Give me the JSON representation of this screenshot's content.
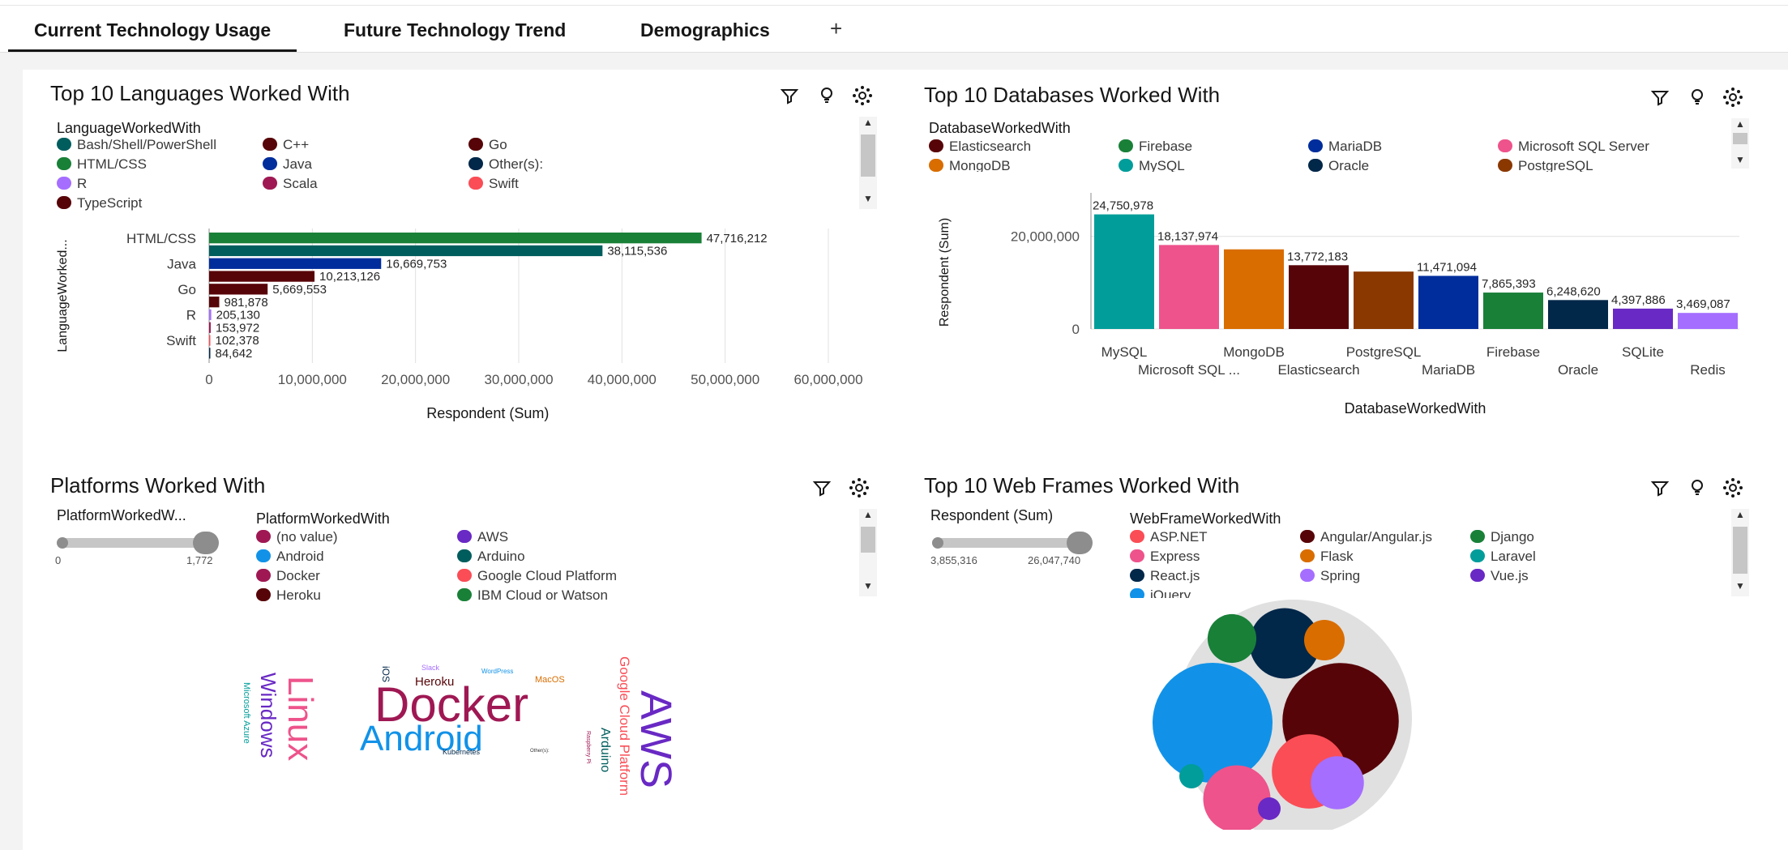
{
  "tabs": [
    {
      "label": "Current Technology Usage"
    },
    {
      "label": "Future Technology Trend"
    },
    {
      "label": "Demographics"
    }
  ],
  "tab_add_label": "+",
  "colors": {
    "accent": "#161616"
  },
  "panels": {
    "languages": {
      "title": "Top 10 Languages Worked With",
      "legend_title": "LanguageWorkedWith",
      "legend": [
        {
          "label": "Bash/Shell/PowerShell",
          "color": "#005d5d"
        },
        {
          "label": "C++",
          "color": "#570408"
        },
        {
          "label": "Go",
          "color": "#570408"
        },
        {
          "label": "HTML/CSS",
          "color": "#198038"
        },
        {
          "label": "Java",
          "color": "#002d9c"
        },
        {
          "label": "Other(s):",
          "color": "#012749"
        },
        {
          "label": "R",
          "color": "#a56eff"
        },
        {
          "label": "Scala",
          "color": "#9f1853"
        },
        {
          "label": "Swift",
          "color": "#fa4d56"
        },
        {
          "label": "TypeScript",
          "color": "#570408"
        }
      ],
      "ylabel": "LanguageWorked...",
      "xlabel": "Respondent (Sum)"
    },
    "databases": {
      "title": "Top 10 Databases Worked With",
      "legend_title": "DatabaseWorkedWith",
      "legend": [
        {
          "label": "Elasticsearch",
          "color": "#570408"
        },
        {
          "label": "Firebase",
          "color": "#198038"
        },
        {
          "label": "MariaDB",
          "color": "#002d9c"
        },
        {
          "label": "Microsoft SQL Server",
          "color": "#ee538b"
        },
        {
          "label": "MongoDB",
          "color": "#d96d00"
        },
        {
          "label": "MySQL",
          "color": "#009d9a"
        },
        {
          "label": "Oracle",
          "color": "#012749"
        },
        {
          "label": "PostgreSQL",
          "color": "#8a3800"
        }
      ],
      "ylabel": "Respondent (Sum)",
      "xlabel": "DatabaseWorkedWith"
    },
    "platforms": {
      "title": "Platforms Worked With",
      "slider_title": "PlatformWorkedW...",
      "slider_min": "0",
      "slider_max": "1,772",
      "legend_title": "PlatformWorkedWith",
      "legend": [
        {
          "label": "(no value)",
          "color": "#9f1853"
        },
        {
          "label": "AWS",
          "color": "#6929c4"
        },
        {
          "label": "Android",
          "color": "#1192e8"
        },
        {
          "label": "Arduino",
          "color": "#005d5d"
        },
        {
          "label": "Docker",
          "color": "#9f1853"
        },
        {
          "label": "Google Cloud Platform",
          "color": "#fa4d56"
        },
        {
          "label": "Heroku",
          "color": "#570408"
        },
        {
          "label": "IBM Cloud or Watson",
          "color": "#198038"
        }
      ],
      "words": [
        {
          "text": "Docker",
          "color": "#9f1853"
        },
        {
          "text": "Android",
          "color": "#1192e8"
        },
        {
          "text": "AWS",
          "color": "#6929c4"
        },
        {
          "text": "Linux",
          "color": "#ee538b"
        },
        {
          "text": "Windows",
          "color": "#6929c4"
        },
        {
          "text": "Microsoft Azure",
          "color": "#009d9a"
        },
        {
          "text": "Google Cloud Platform",
          "color": "#fa4d56"
        },
        {
          "text": "Arduino",
          "color": "#005d5d"
        },
        {
          "text": "Heroku",
          "color": "#570408"
        },
        {
          "text": "iOS",
          "color": "#012749"
        },
        {
          "text": "Slack",
          "color": "#a56eff"
        },
        {
          "text": "WordPress",
          "color": "#1192e8"
        },
        {
          "text": "MacOS",
          "color": "#d96d00"
        },
        {
          "text": "Kubernetes",
          "color": "#012749"
        },
        {
          "text": "Raspberry Pi",
          "color": "#9f1853"
        },
        {
          "text": "Other(s):",
          "color": "#333333"
        }
      ]
    },
    "webframes": {
      "title": "Top 10 Web Frames Worked With",
      "slider_title": "Respondent (Sum)",
      "slider_min": "3,855,316",
      "slider_max": "26,047,740",
      "legend_title": "WebFrameWorkedWith",
      "legend": [
        {
          "label": "ASP.NET",
          "color": "#fa4d56"
        },
        {
          "label": "Angular/Angular.js",
          "color": "#570408"
        },
        {
          "label": "Django",
          "color": "#198038"
        },
        {
          "label": "Express",
          "color": "#ee538b"
        },
        {
          "label": "Flask",
          "color": "#d96d00"
        },
        {
          "label": "Laravel",
          "color": "#009d9a"
        },
        {
          "label": "React.js",
          "color": "#012749"
        },
        {
          "label": "Spring",
          "color": "#a56eff"
        },
        {
          "label": "Vue.js",
          "color": "#6929c4"
        },
        {
          "label": "jQuery",
          "color": "#1192e8"
        }
      ]
    }
  },
  "chart_data": [
    {
      "type": "bar",
      "orientation": "horizontal",
      "title": "Top 10 Languages Worked With",
      "xlabel": "Respondent (Sum)",
      "ylabel": "LanguageWorked...",
      "xlim": [
        0,
        60000000
      ],
      "x_ticks": [
        "0",
        "10,000,000",
        "20,000,000",
        "30,000,000",
        "40,000,000",
        "50,000,000",
        "60,000,000"
      ],
      "categories": [
        "HTML/CSS",
        "Bash/Shell/PowerShell",
        "Java",
        "C++",
        "Go",
        "TypeScript",
        "R",
        "Scala",
        "Swift",
        "Other(s):"
      ],
      "category_labels_shown": [
        "HTML/CSS",
        "",
        "Java",
        "",
        "Go",
        "",
        "R",
        "",
        "Swift",
        ""
      ],
      "values": [
        47716212,
        38115536,
        16669753,
        10213126,
        5669553,
        981878,
        205130,
        153972,
        102378,
        84642
      ],
      "value_labels": [
        "47,716,212",
        "38,115,536",
        "16,669,753",
        "10,213,126",
        "5,669,553",
        "981,878",
        "205,130",
        "153,972",
        "102,378",
        "84,642"
      ],
      "colors": [
        "#198038",
        "#005d5d",
        "#002d9c",
        "#570408",
        "#570408",
        "#570408",
        "#a56eff",
        "#9f1853",
        "#fa4d56",
        "#012749"
      ],
      "grid": true
    },
    {
      "type": "bar",
      "title": "Top 10 Databases Worked With",
      "xlabel": "DatabaseWorkedWith",
      "ylabel": "Respondent (Sum)",
      "ylim": [
        0,
        28000000
      ],
      "y_ticks": [
        {
          "value": 0,
          "label": "0"
        },
        {
          "value": 20000000,
          "label": "20,000,000"
        }
      ],
      "categories": [
        "MySQL",
        "Microsoft SQL ...",
        "MongoDB",
        "Elasticsearch",
        "PostgreSQL",
        "MariaDB",
        "Firebase",
        "Oracle",
        "SQLite",
        "Redis"
      ],
      "values": [
        24750978,
        18137974,
        17200000,
        13772183,
        12400000,
        11471094,
        7865393,
        6248620,
        4397886,
        3469087
      ],
      "value_labels": [
        "24,750,978",
        "18,137,974",
        "",
        "13,772,183",
        "",
        "11,471,094",
        "7,865,393",
        "6,248,620",
        "4,397,886",
        "3,469,087"
      ],
      "colors": [
        "#009d9a",
        "#ee538b",
        "#d96d00",
        "#570408",
        "#8a3800",
        "#002d9c",
        "#198038",
        "#012749",
        "#6929c4",
        "#a56eff"
      ],
      "grid": true
    },
    {
      "type": "bubble",
      "title": "Top 10 Web Frames Worked With",
      "categories": [
        "jQuery",
        "Angular/Angular.js",
        "React.js",
        "ASP.NET",
        "Express",
        "Spring",
        "Django",
        "Flask",
        "Laravel",
        "Vue.js"
      ],
      "values": [
        26047740,
        24500000,
        9000000,
        10000000,
        8200000,
        5100000,
        4300000,
        3855316,
        3855316,
        3855316
      ],
      "colors": [
        "#1192e8",
        "#570408",
        "#012749",
        "#fa4d56",
        "#ee538b",
        "#a56eff",
        "#198038",
        "#d96d00",
        "#009d9a",
        "#6929c4"
      ]
    }
  ]
}
